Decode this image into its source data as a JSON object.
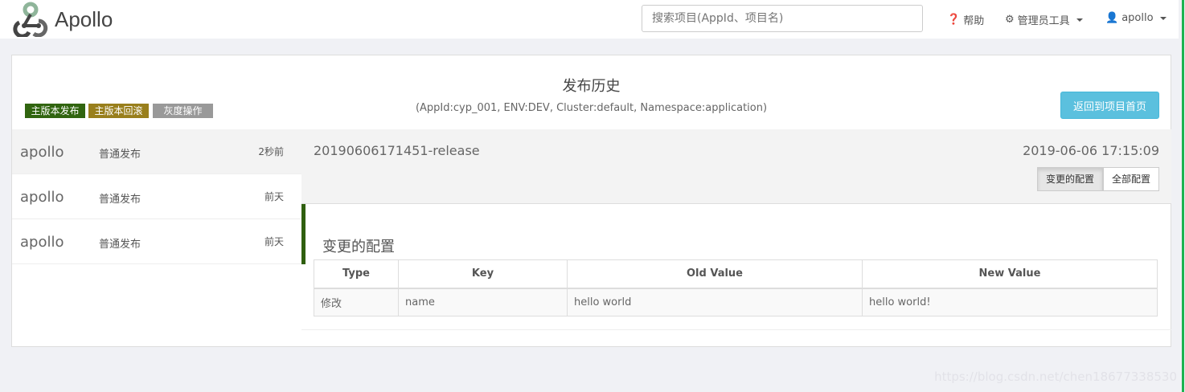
{
  "nav": {
    "brand": "Apollo",
    "search_placeholder": "搜索项目(AppId、项目名)",
    "help": "帮助",
    "admin_tools": "管理员工具",
    "user": "apollo"
  },
  "page": {
    "title": "发布历史",
    "subtitle": "(AppId:cyp_001, ENV:DEV, Cluster:default, Namespace:application)",
    "back_button": "返回到项目首页",
    "legend": [
      {
        "label": "主版本发布",
        "color": "#316510"
      },
      {
        "label": "主版本回滚",
        "color": "#997f1c"
      },
      {
        "label": "灰度操作",
        "color": "#999999"
      }
    ]
  },
  "history": [
    {
      "operator": "apollo",
      "type": "普通发布",
      "time": "2秒前",
      "active": true
    },
    {
      "operator": "apollo",
      "type": "普通发布",
      "time": "前天",
      "active": false
    },
    {
      "operator": "apollo",
      "type": "普通发布",
      "time": "前天",
      "active": false
    }
  ],
  "detail": {
    "release_name": "20190606171451-release",
    "date": "2019-06-06 17:15:09",
    "tab_changed": "变更的配置",
    "tab_all": "全部配置",
    "section_title": "变更的配置",
    "columns": [
      "Type",
      "Key",
      "Old Value",
      "New Value"
    ],
    "rows": [
      [
        "修改",
        "name",
        "hello world",
        "hello world!"
      ]
    ]
  },
  "watermark": "https://blog.csdn.net/chen18677338530"
}
